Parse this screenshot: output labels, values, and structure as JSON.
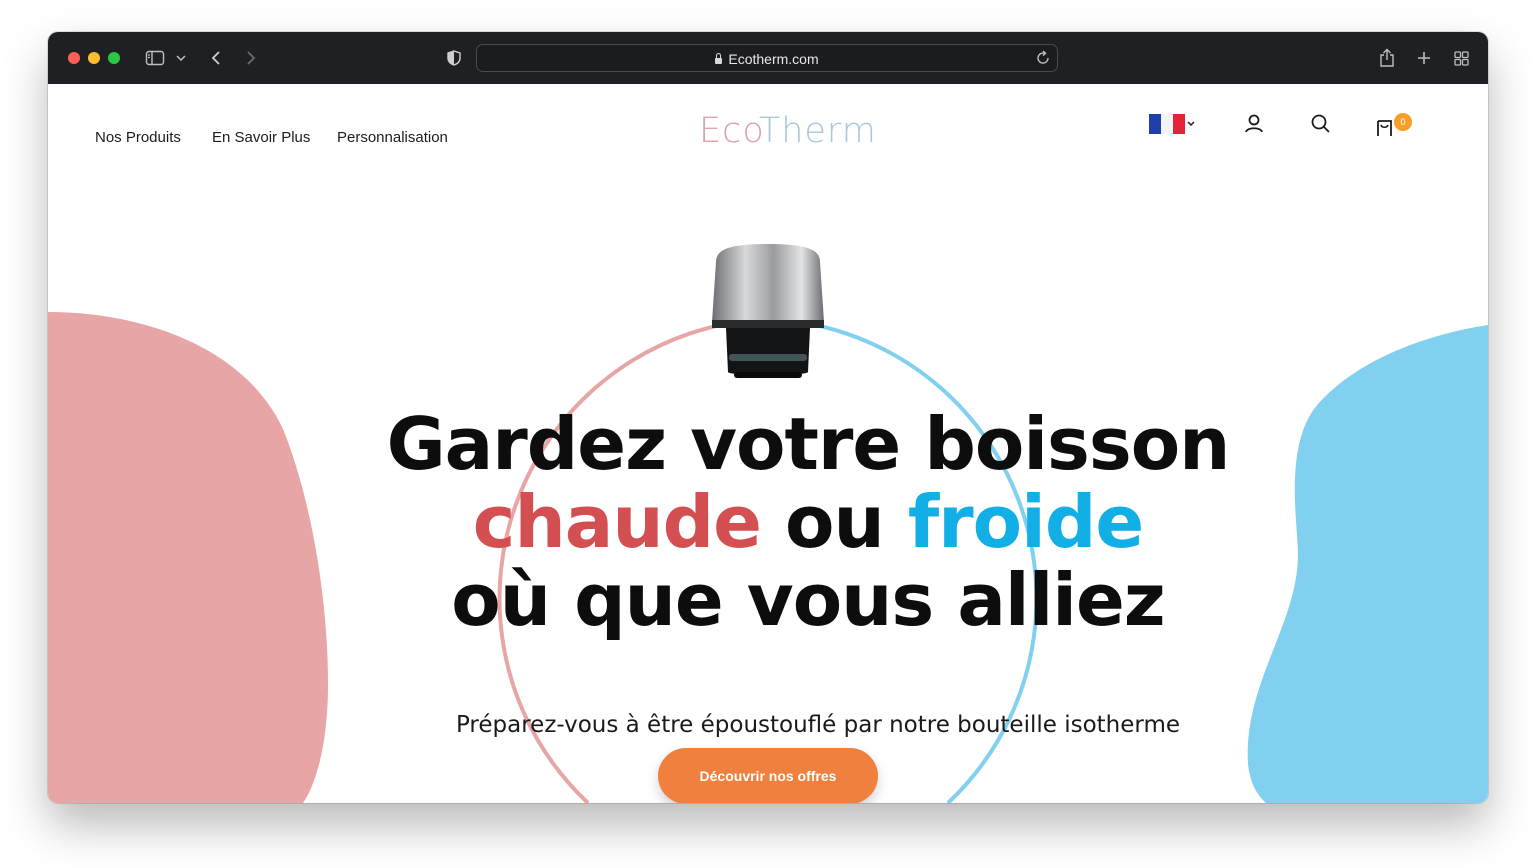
{
  "browser": {
    "url": "Ecotherm.com",
    "icons": [
      "sidebar-icon",
      "chevron-down-icon",
      "back-icon",
      "forward-icon",
      "shield-icon",
      "lock-icon",
      "reload-icon",
      "share-icon",
      "new-tab-icon",
      "tab-overview-icon"
    ]
  },
  "nav": {
    "links": [
      "Nos Produits",
      "En Savoir Plus",
      "Personnalisation"
    ]
  },
  "logo": {
    "part1": "Eco",
    "part2": "Therm"
  },
  "header_icons": {
    "language_flag": "france-flag-icon",
    "account": "user-icon",
    "search": "search-icon",
    "cart": "cart-icon",
    "cart_count": "0"
  },
  "hero": {
    "line1": "Gardez votre boisson",
    "hot_word": "chaude",
    "connector": "ou",
    "cold_word": "froide",
    "line3": "où que vous alliez",
    "subtitle": "Préparez-vous à être époustouflé par notre bouteille isotherme",
    "cta": "Découvrir nos offres"
  },
  "colors": {
    "hot": "#d34f51",
    "cold": "#12aee6",
    "blob_left": "#e8a5a5",
    "blob_right": "#82d0f0",
    "cta": "#ef803d"
  }
}
